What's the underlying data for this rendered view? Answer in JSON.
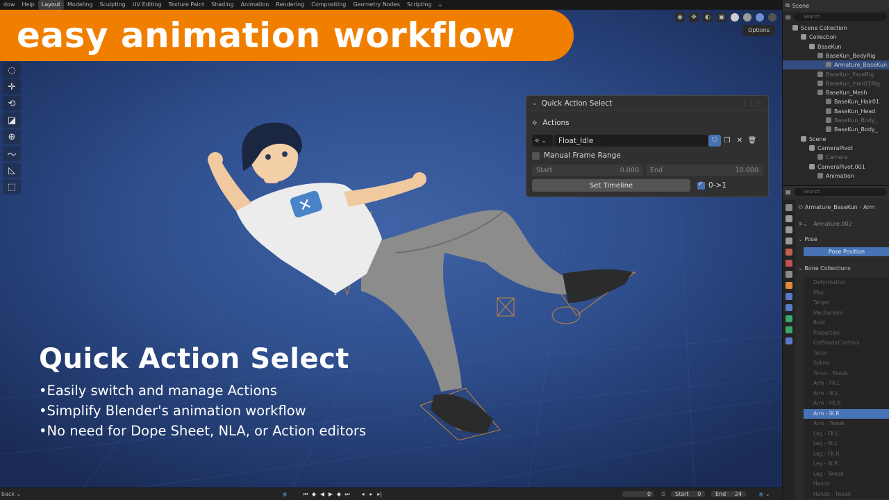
{
  "menu": {
    "items": [
      "dow",
      "Help",
      "Layout",
      "Modeling",
      "Sculpting",
      "UV Editing",
      "Texture Paint",
      "Shading",
      "Animation",
      "Rendering",
      "Compositing",
      "Geometry Nodes",
      "Scripting"
    ],
    "active": "Layout",
    "add_tab": "+"
  },
  "banner": {
    "text": "easy animation workflow"
  },
  "viewport": {
    "options_label": "Options",
    "accent": "#f07f00",
    "background": "#2f4f8e"
  },
  "panel": {
    "title": "Quick Action Select",
    "actions_label": "Actions",
    "action_name": "Float_Idle",
    "manual_frame_range_label": "Manual Frame Range",
    "manual_frame_range_checked": false,
    "start_label": "Start",
    "start_value": "0.000",
    "end_label": "End",
    "end_value": "10.000",
    "set_timeline_label": "Set Timeline",
    "range_toggle_label": "0->1",
    "range_toggle_checked": true,
    "icons": [
      "action-icon",
      "fake-user-shield-icon",
      "duplicate-icon",
      "unlink-icon",
      "delete-icon"
    ]
  },
  "promo": {
    "title": "Quick Action Select",
    "bullets": [
      "•Easily switch and manage Actions",
      "•Simplify Blender's animation workflow",
      "•No need for Dope Sheet, NLA, or Action editors"
    ]
  },
  "timeline": {
    "playback_label": "back",
    "current_frame": "0",
    "start_label": "Start",
    "start_value": "0",
    "end_label": "End",
    "end_value": "24"
  },
  "outliner": {
    "scene_label": "Scene",
    "search_placeholder": "Search",
    "rows": [
      {
        "label": "Scene Collection",
        "indent": 0,
        "dim": false,
        "selected": false
      },
      {
        "label": "Collection",
        "indent": 1,
        "dim": false,
        "selected": false
      },
      {
        "label": "BaseKun",
        "indent": 2,
        "dim": false,
        "selected": false
      },
      {
        "label": "BaseKun_BodyRig",
        "indent": 3,
        "dim": false,
        "selected": false
      },
      {
        "label": "Armature_BaseKun",
        "indent": 4,
        "dim": false,
        "selected": true
      },
      {
        "label": "BaseKun_FaceRig",
        "indent": 3,
        "dim": true,
        "selected": false
      },
      {
        "label": "BaseKun_Hair01Rig",
        "indent": 3,
        "dim": true,
        "selected": false
      },
      {
        "label": "BaseKun_Mesh",
        "indent": 3,
        "dim": false,
        "selected": false
      },
      {
        "label": "BaseKun_Hair01",
        "indent": 4,
        "dim": false,
        "selected": false
      },
      {
        "label": "BaseKun_Head",
        "indent": 4,
        "dim": false,
        "selected": false
      },
      {
        "label": "BaseKun_Body_",
        "indent": 4,
        "dim": true,
        "selected": false
      },
      {
        "label": "BaseKun_Body_",
        "indent": 4,
        "dim": false,
        "selected": false
      },
      {
        "label": "Scene",
        "indent": 1,
        "dim": false,
        "selected": false
      },
      {
        "label": "CameraPivot",
        "indent": 2,
        "dim": false,
        "selected": false
      },
      {
        "label": "Camera",
        "indent": 3,
        "dim": true,
        "selected": false
      },
      {
        "label": "CameraPivot.001",
        "indent": 2,
        "dim": false,
        "selected": false
      },
      {
        "label": "Animation",
        "indent": 3,
        "dim": false,
        "selected": false
      }
    ]
  },
  "properties": {
    "search_placeholder": "Search",
    "object_name": "Armature_BaseKun",
    "object_name_trunc": "Arm",
    "armature_data": "Armature.002",
    "pose_section": "Pose",
    "pose_position_label": "Pose Position",
    "bone_collections_section": "Bone Collections",
    "bone_collections": [
      "Deformation",
      "Misc",
      "Target",
      "Mechanism",
      "Root",
      "Properties",
      "CelShadeControls",
      "Torso",
      "Spline",
      "Torso - Tweak",
      "Arm - FK.L",
      "Arm - IK.L",
      "Arm - FK.R",
      "Arm - IK.R",
      "Arm - Tweak",
      "Leg - FK.L",
      "Leg - IK.L",
      "Leg - FK.R",
      "Leg - IK.R",
      "Leg - Tweak",
      "Hands",
      "Hands - Tweak"
    ],
    "selected_bone_collection": "Arm - IK.R"
  }
}
